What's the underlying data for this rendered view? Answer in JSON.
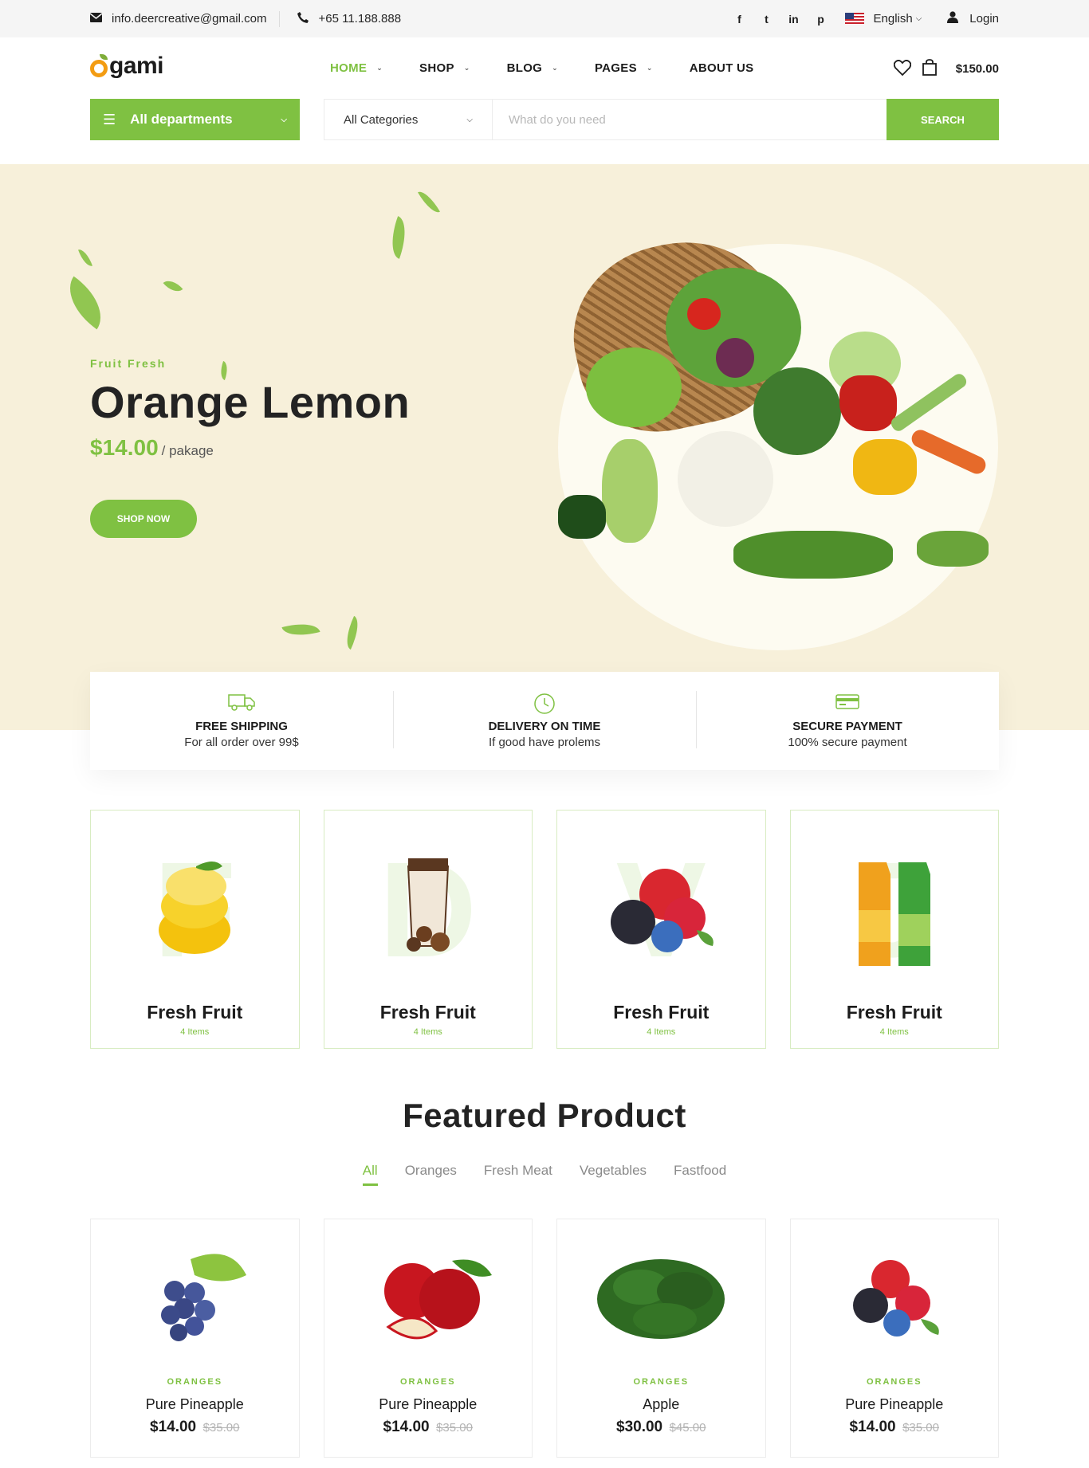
{
  "topbar": {
    "email": "info.deercreative@gmail.com",
    "phone": "+65 11.188.888",
    "social": [
      "f",
      "t",
      "in",
      "p"
    ],
    "language": "English",
    "login": "Login"
  },
  "header": {
    "logo_text": "gami",
    "nav": [
      {
        "label": "HOME",
        "active": true,
        "dropdown": true
      },
      {
        "label": "SHOP",
        "active": false,
        "dropdown": true
      },
      {
        "label": "BLOG",
        "active": false,
        "dropdown": true
      },
      {
        "label": "PAGES",
        "active": false,
        "dropdown": true
      },
      {
        "label": "ABOUT US",
        "active": false,
        "dropdown": false
      }
    ],
    "cart_total": "$150.00"
  },
  "search": {
    "departments_label": "All departments",
    "category_label": "All Categories",
    "placeholder": "What do you need",
    "button": "SEARCH"
  },
  "hero": {
    "subtitle": "Fruit Fresh",
    "title": "Orange Lemon",
    "price": "$14.00",
    "unit": "/ pakage",
    "button": "SHOP NOW"
  },
  "features": [
    {
      "title": "FREE SHIPPING",
      "desc": "For all order over 99$",
      "icon": "truck-icon"
    },
    {
      "title": "DELIVERY ON TIME",
      "desc": "If good have prolems",
      "icon": "clock-icon"
    },
    {
      "title": "SECURE PAYMENT",
      "desc": "100% secure payment",
      "icon": "credit-card-icon"
    }
  ],
  "categories": [
    {
      "letter": "F",
      "name": "Fresh Fruit",
      "count": "4 Items"
    },
    {
      "letter": "D",
      "name": "Fresh Fruit",
      "count": "4 Items"
    },
    {
      "letter": "V",
      "name": "Fresh Fruit",
      "count": "4 Items"
    },
    {
      "letter": "J",
      "name": "Fresh Fruit",
      "count": "4 Items"
    }
  ],
  "featured": {
    "title": "Featured Product",
    "tabs": [
      "All",
      "Oranges",
      "Fresh Meat",
      "Vegetables",
      "Fastfood"
    ],
    "products": [
      {
        "category": "ORANGES",
        "name": "Pure Pineapple",
        "price": "$14.00",
        "old_price": "$35.00"
      },
      {
        "category": "ORANGES",
        "name": "Pure Pineapple",
        "price": "$14.00",
        "old_price": "$35.00"
      },
      {
        "category": "ORANGES",
        "name": "Apple",
        "price": "$30.00",
        "old_price": "$45.00"
      },
      {
        "category": "ORANGES",
        "name": "Pure Pineapple",
        "price": "$14.00",
        "old_price": "$35.00"
      }
    ]
  },
  "colors": {
    "accent": "#7fc142",
    "hero_bg": "#f7f0da"
  }
}
